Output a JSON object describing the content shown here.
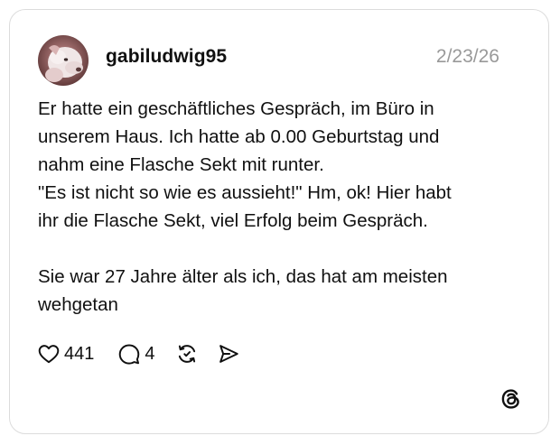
{
  "post": {
    "username": "gabiludwig95",
    "date": "2/23/26",
    "text_lines": [
      "Er hatte ein geschäftliches Gespräch, im Büro in",
      "unserem Haus. Ich hatte ab 0.00 Geburtstag und",
      "nahm eine Flasche Sekt mit runter.",
      "\"Es ist nicht so wie es aussieht!\" Hm, ok! Hier habt",
      "ihr die Flasche Sekt, viel Erfolg beim Gespräch.",
      "",
      "Sie war 27 Jahre älter als ich, das hat am meisten",
      "wehgetan"
    ]
  },
  "actions": {
    "likes": "441",
    "replies": "4",
    "icons": [
      "heart-icon",
      "comment-icon",
      "repost-icon",
      "share-icon"
    ]
  },
  "brand": {
    "logo": "threads-logo-icon"
  },
  "colors": {
    "text": "#101010",
    "muted": "#999999",
    "border": "#dcdcdc"
  }
}
